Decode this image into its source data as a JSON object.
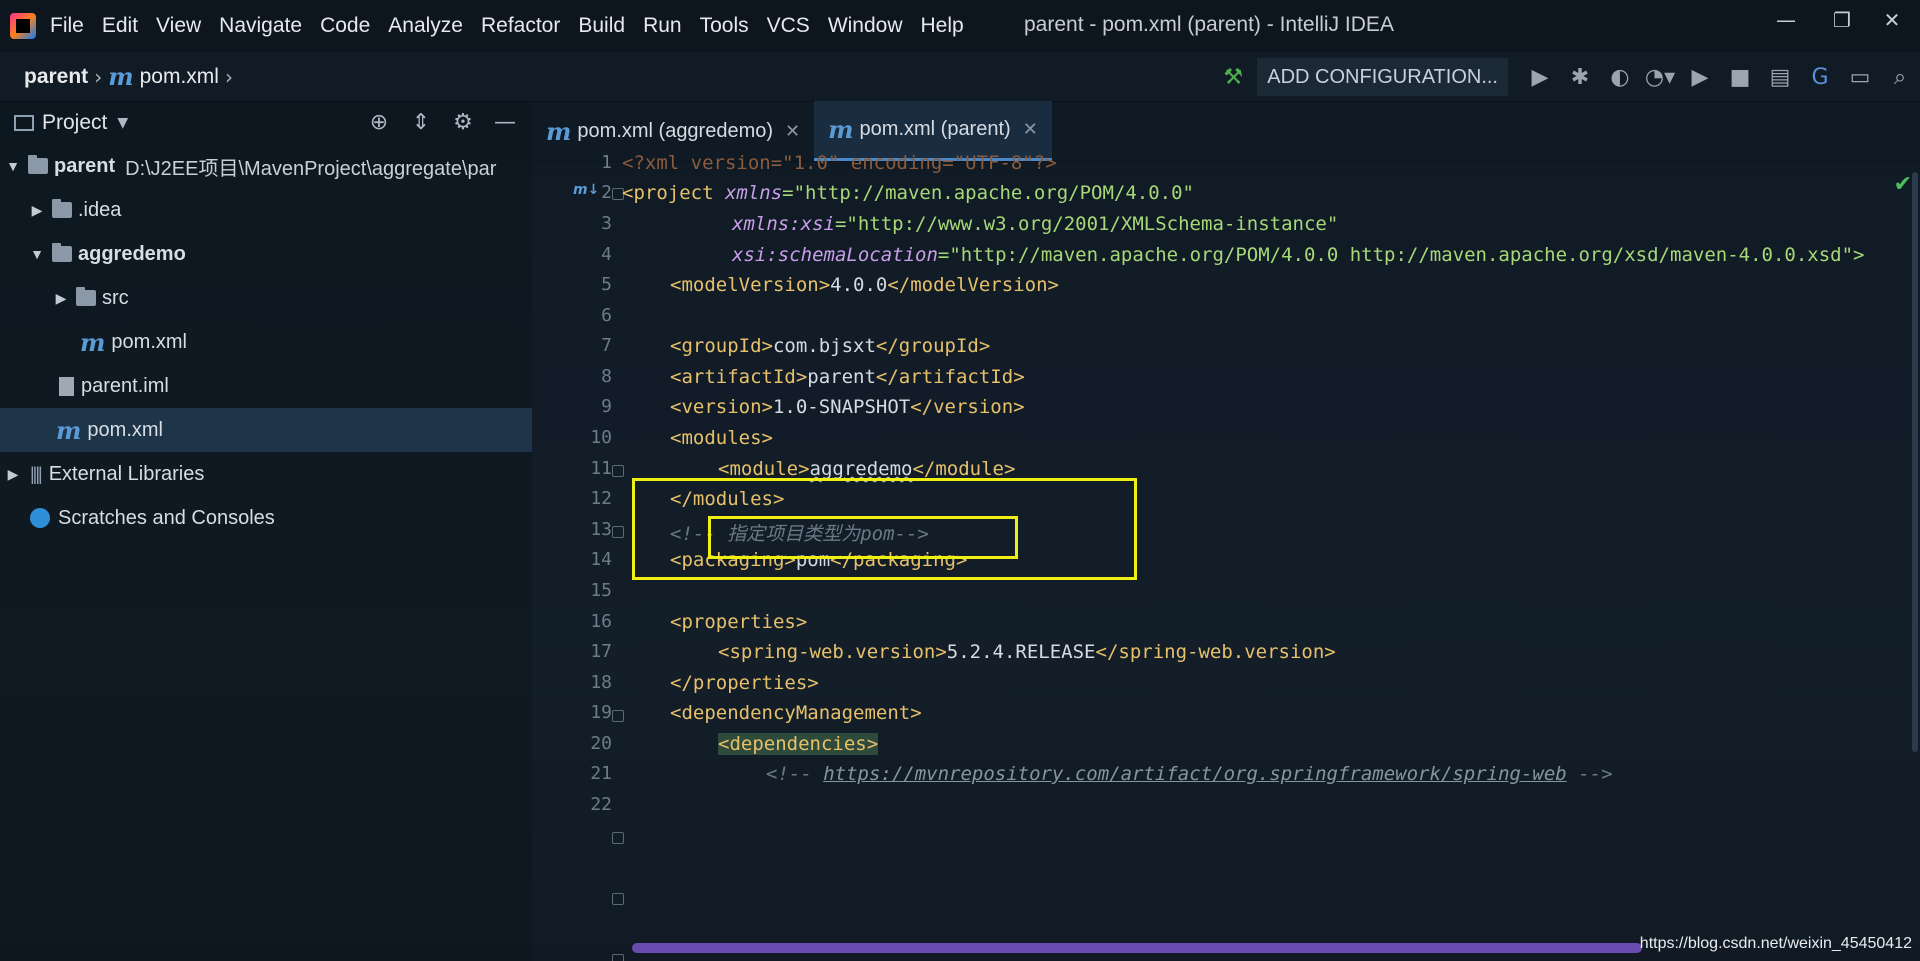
{
  "window": {
    "title": "parent - pom.xml (parent) - IntelliJ IDEA",
    "controls": {
      "minimize": "—",
      "restore": "❐",
      "close": "✕"
    }
  },
  "menu": [
    "File",
    "Edit",
    "View",
    "Navigate",
    "Code",
    "Analyze",
    "Refactor",
    "Build",
    "Run",
    "Tools",
    "VCS",
    "Window",
    "Help"
  ],
  "navbar": {
    "breadcrumbs": [
      "parent",
      "pom.xml"
    ],
    "run_config_label": "ADD CONFIGURATION...",
    "icons": [
      "hammer-icon",
      "run-icon",
      "debug-icon",
      "coverage-icon",
      "profile-icon",
      "play-icon",
      "stop-icon",
      "project-structure-icon",
      "translate-icon",
      "terminal-icon",
      "search-icon"
    ]
  },
  "project_panel": {
    "title": "Project",
    "tree": [
      {
        "label": "parent",
        "path": "D:\\J2EE项目\\MavenProject\\aggregate\\par",
        "type": "module",
        "expanded": true,
        "indent": 0
      },
      {
        "label": ".idea",
        "type": "folder",
        "expanded": false,
        "indent": 1
      },
      {
        "label": "aggredemo",
        "type": "module",
        "expanded": true,
        "indent": 1
      },
      {
        "label": "src",
        "type": "folder",
        "expanded": false,
        "indent": 2
      },
      {
        "label": "pom.xml",
        "type": "maven",
        "indent": 2
      },
      {
        "label": "parent.iml",
        "type": "file",
        "indent": 1
      },
      {
        "label": "pom.xml",
        "type": "maven",
        "indent": 1,
        "selected": true
      },
      {
        "label": "External Libraries",
        "type": "library",
        "expanded": false,
        "indent": 0
      },
      {
        "label": "Scratches and Consoles",
        "type": "scratch",
        "indent": 0
      }
    ]
  },
  "editor": {
    "tabs": [
      {
        "label": "pom.xml (aggredemo)",
        "active": false
      },
      {
        "label": "pom.xml (parent)",
        "active": true
      }
    ],
    "line_numbers": [
      "1",
      "2",
      "3",
      "4",
      "5",
      "6",
      "7",
      "8",
      "9",
      "10",
      "11",
      "12",
      "13",
      "14",
      "15",
      "16",
      "17",
      "18",
      "19",
      "20",
      "21",
      "22"
    ],
    "lines": {
      "l1": "<?xml version=\"1.0\" encoding=\"UTF-8\"?>",
      "l2_tag": "<project ",
      "l2_attr": "xmlns",
      "l2_val": "=\"http://maven.apache.org/POM/4.0.0\"",
      "l3_attr": "xmlns:xsi",
      "l3_val": "=\"http://www.w3.org/2001/XMLSchema-instance\"",
      "l4_attr": "xsi:schemaLocation",
      "l4_val": "=\"http://maven.apache.org/POM/4.0.0 http://maven.apache.org/xsd/maven-4.0.0.xsd\">",
      "l5_open": "<modelVersion>",
      "l5_text": "4.0.0",
      "l5_close": "</modelVersion>",
      "l7_open": "<groupId>",
      "l7_text": "com.bjsxt",
      "l7_close": "</groupId>",
      "l8_open": "<artifactId>",
      "l8_text": "parent",
      "l8_close": "</artifactId>",
      "l9_open": "<version>",
      "l9_text": "1.0-SNAPSHOT",
      "l9_close": "</version>",
      "l10": "<modules>",
      "l11_open": "<module>",
      "l11_text": "aggredemo",
      "l11_close": "</module>",
      "l12": "</modules>",
      "l13": "<!-- 指定项目类型为pom-->",
      "l14_open": "<packaging>",
      "l14_text": "pom",
      "l14_close": "</packaging>",
      "l16": "<properties>",
      "l17_open": "<spring-web.version>",
      "l17_text": "5.2.4.RELEASE",
      "l17_close": "</spring-web.version>",
      "l18": "</properties>",
      "l19": "<dependencyManagement>",
      "l20": "<dependencies>",
      "l21_prefix": "<!-- ",
      "l21_link": "https://mvnrepository.com/artifact/org.springframework/spring-web",
      "l21_suffix": " -->"
    }
  },
  "watermark": "https://blog.csdn.net/weixin_45450412",
  "colors": {
    "highlight": "#f0ef12",
    "accent": "#4a88c7",
    "tag": "#e7c06a",
    "value": "#a6d877"
  }
}
